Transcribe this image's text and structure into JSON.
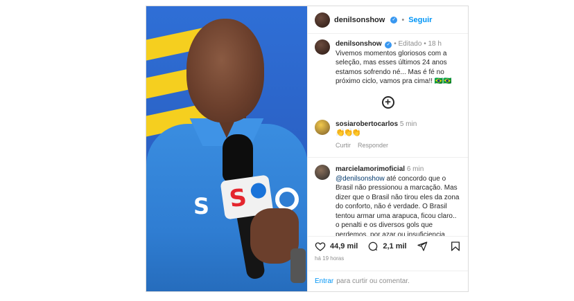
{
  "header": {
    "username": "denilsonshow",
    "dot": "•",
    "follow_label": "Seguir"
  },
  "caption": {
    "username": "denilsonshow",
    "edited": "• Editado • 18 h",
    "text": "Vivemos momentos gloriosos com a seleção, mas esses últimos 24 anos estamos sofrendo né... Mas é fé no próximo ciclo, vamos pra cima!! 🇧🇷🇧🇷"
  },
  "comments": [
    {
      "username": "sosiarobertocarlos",
      "time": "5 min",
      "text": "👏👏👏",
      "reply_actions": [
        "Curtir",
        "Responder"
      ]
    },
    {
      "username": "marcielamorimoficial",
      "time": "6 min",
      "mention": "@denilsonshow",
      "text": " até concordo que o Brasil não pressionou a marcação. Mas dizer que o Brasil não tirou eles da zona do conforto, não é verdade. O Brasil tentou armar uma arapuca, ficou claro.. o penalti e os diversos gols que perdemos, por azar ou insuficiencia técnica, e etc... O que"
    }
  ],
  "actions": {
    "likes": "44,9 mil",
    "comments": "2,1 mil",
    "posted_ago": "há 19 horas"
  },
  "footer": {
    "login_link": "Entrar",
    "login_text": "para curtir ou comentar."
  },
  "media": {
    "logos": [
      "S",
      "S"
    ]
  },
  "icons": [
    "verified-icon",
    "add-circle-icon",
    "heart-icon",
    "comment-icon",
    "share-icon",
    "bookmark-icon"
  ]
}
